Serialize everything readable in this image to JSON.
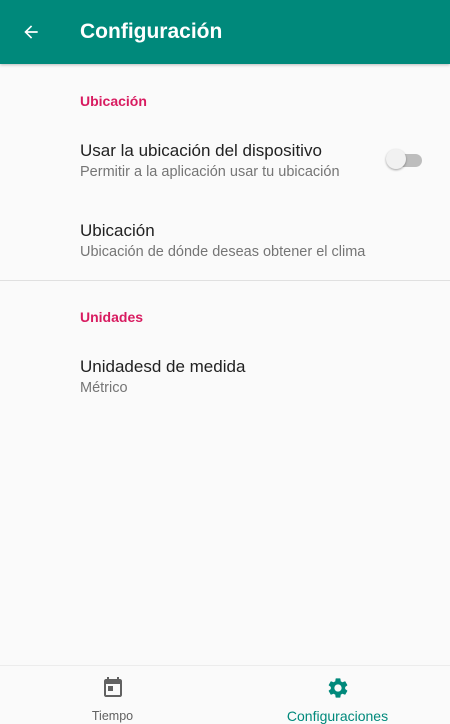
{
  "appbar": {
    "title": "Configuración",
    "back_icon": "arrow-back-icon",
    "background_color": "#00897b"
  },
  "sections": [
    {
      "header": "Ubicación",
      "items": [
        {
          "title": "Usar la ubicación del dispositivo",
          "summary": "Permitir a la aplicación usar tu ubicación",
          "toggle": false
        },
        {
          "title": "Ubicación",
          "summary": "Ubicación de dónde deseas obtener el clima"
        }
      ]
    },
    {
      "header": "Unidades",
      "items": [
        {
          "title": "Unidadesd de medida",
          "summary": "Métrico"
        }
      ]
    }
  ],
  "bottom_nav": {
    "items": [
      {
        "label": "Tiempo",
        "icon": "calendar-icon",
        "active": false
      },
      {
        "label": "Configuraciones",
        "icon": "gear-icon",
        "active": true
      }
    ]
  },
  "colors": {
    "accent": "#00897b",
    "section_header": "#d81b60"
  }
}
